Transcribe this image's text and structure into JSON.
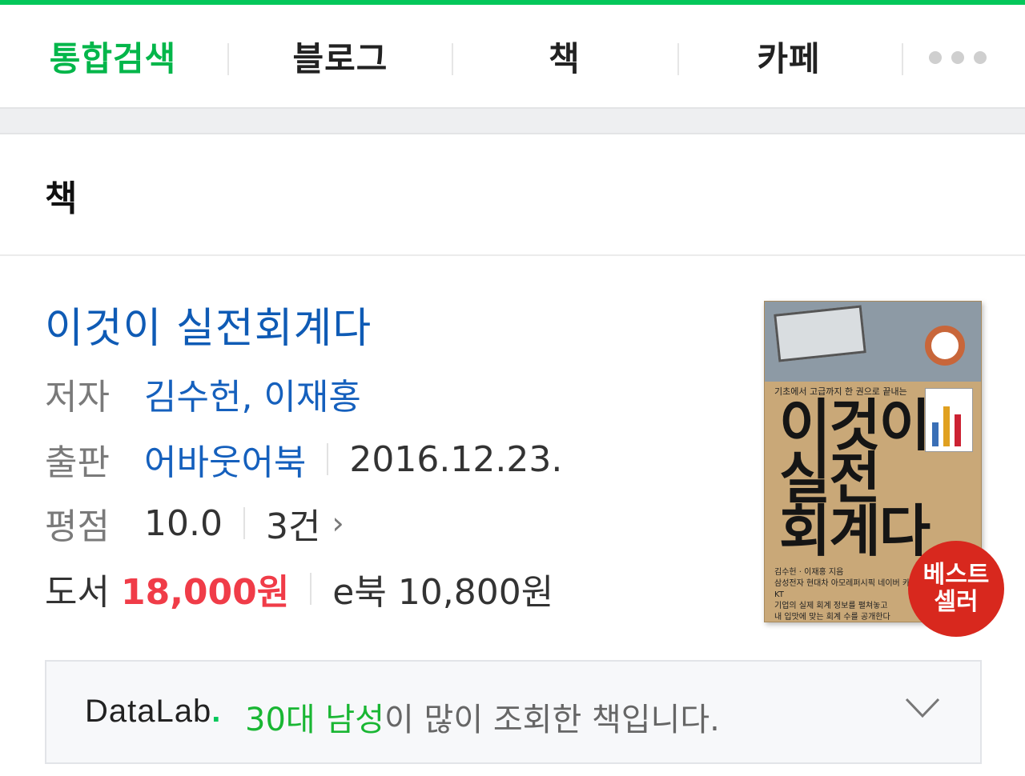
{
  "colors": {
    "accent_green": "#03c75a",
    "link_blue": "#1560bd",
    "price_red": "#f03c48",
    "badge_red": "#d8281e"
  },
  "tabs": [
    {
      "label": "통합검색",
      "active": true
    },
    {
      "label": "블로그",
      "active": false
    },
    {
      "label": "책",
      "active": false
    },
    {
      "label": "카페",
      "active": false
    }
  ],
  "more_icon": "more-dots-icon",
  "section": {
    "title": "책"
  },
  "book": {
    "title": "이것이 실전회계다",
    "author_label": "저자",
    "authors": "김수헌, 이재홍",
    "publisher_label": "출판",
    "publisher": "어바웃어북",
    "date": "2016.12.23.",
    "rating_label": "평점",
    "rating": "10.0",
    "review_count": "3건",
    "price_label": "도서",
    "price": "18,000원",
    "ebook_label": "e북",
    "ebook_price": "10,800원"
  },
  "cover": {
    "tagline": "기초에서 고급까지 한 권으로 끝내는",
    "title_line1": "이것이",
    "title_line2": "실전",
    "title_line3": "회계다",
    "author_line": "김수헌 · 이재홍 지음",
    "blurb_line1": "삼성전자 현대차 아모레퍼시픽 네이버 카카오 KT",
    "blurb_line2": "기업의 실제 회계 정보를 펼쳐놓고",
    "blurb_line3": "내 입맛에 맞는 회계 수를 공개한다",
    "badge_line1": "베스트",
    "badge_line2": "셀러"
  },
  "datalab": {
    "logo_text": "DataLab",
    "logo_dot": ".",
    "highlight": "30대 남성",
    "text": "이 많이 조회한 책입니다.",
    "chevron_icon": "chevron-down-icon"
  }
}
